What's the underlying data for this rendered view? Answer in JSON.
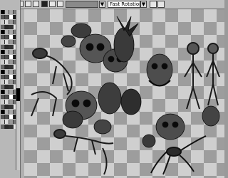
{
  "toolbar": {
    "rotation_mode": "Fast Rotation",
    "dropdown_arrow": "▼"
  },
  "palette": {
    "colors": [
      "#000000",
      "#1a1a1a",
      "#333333",
      "#4d4d4d",
      "#666666",
      "#808080",
      "#999999",
      "#b3b3b3",
      "#cccccc",
      "#e6e6e6",
      "#ffffff",
      "#2a2a2a",
      "#555555",
      "#777777",
      "#aaaaaa",
      "#dddddd"
    ]
  },
  "canvas": {
    "content": "skeletons-and-skulls-artwork"
  }
}
